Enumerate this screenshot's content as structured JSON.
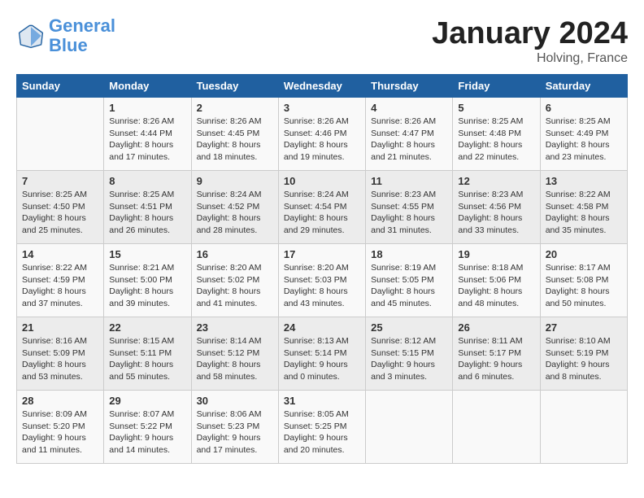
{
  "header": {
    "logo_line1": "General",
    "logo_line2": "Blue",
    "month": "January 2024",
    "location": "Holving, France"
  },
  "days_of_week": [
    "Sunday",
    "Monday",
    "Tuesday",
    "Wednesday",
    "Thursday",
    "Friday",
    "Saturday"
  ],
  "weeks": [
    [
      {
        "day": "",
        "content": ""
      },
      {
        "day": "1",
        "content": "Sunrise: 8:26 AM\nSunset: 4:44 PM\nDaylight: 8 hours\nand 17 minutes."
      },
      {
        "day": "2",
        "content": "Sunrise: 8:26 AM\nSunset: 4:45 PM\nDaylight: 8 hours\nand 18 minutes."
      },
      {
        "day": "3",
        "content": "Sunrise: 8:26 AM\nSunset: 4:46 PM\nDaylight: 8 hours\nand 19 minutes."
      },
      {
        "day": "4",
        "content": "Sunrise: 8:26 AM\nSunset: 4:47 PM\nDaylight: 8 hours\nand 21 minutes."
      },
      {
        "day": "5",
        "content": "Sunrise: 8:25 AM\nSunset: 4:48 PM\nDaylight: 8 hours\nand 22 minutes."
      },
      {
        "day": "6",
        "content": "Sunrise: 8:25 AM\nSunset: 4:49 PM\nDaylight: 8 hours\nand 23 minutes."
      }
    ],
    [
      {
        "day": "7",
        "content": "Sunrise: 8:25 AM\nSunset: 4:50 PM\nDaylight: 8 hours\nand 25 minutes."
      },
      {
        "day": "8",
        "content": "Sunrise: 8:25 AM\nSunset: 4:51 PM\nDaylight: 8 hours\nand 26 minutes."
      },
      {
        "day": "9",
        "content": "Sunrise: 8:24 AM\nSunset: 4:52 PM\nDaylight: 8 hours\nand 28 minutes."
      },
      {
        "day": "10",
        "content": "Sunrise: 8:24 AM\nSunset: 4:54 PM\nDaylight: 8 hours\nand 29 minutes."
      },
      {
        "day": "11",
        "content": "Sunrise: 8:23 AM\nSunset: 4:55 PM\nDaylight: 8 hours\nand 31 minutes."
      },
      {
        "day": "12",
        "content": "Sunrise: 8:23 AM\nSunset: 4:56 PM\nDaylight: 8 hours\nand 33 minutes."
      },
      {
        "day": "13",
        "content": "Sunrise: 8:22 AM\nSunset: 4:58 PM\nDaylight: 8 hours\nand 35 minutes."
      }
    ],
    [
      {
        "day": "14",
        "content": "Sunrise: 8:22 AM\nSunset: 4:59 PM\nDaylight: 8 hours\nand 37 minutes."
      },
      {
        "day": "15",
        "content": "Sunrise: 8:21 AM\nSunset: 5:00 PM\nDaylight: 8 hours\nand 39 minutes."
      },
      {
        "day": "16",
        "content": "Sunrise: 8:20 AM\nSunset: 5:02 PM\nDaylight: 8 hours\nand 41 minutes."
      },
      {
        "day": "17",
        "content": "Sunrise: 8:20 AM\nSunset: 5:03 PM\nDaylight: 8 hours\nand 43 minutes."
      },
      {
        "day": "18",
        "content": "Sunrise: 8:19 AM\nSunset: 5:05 PM\nDaylight: 8 hours\nand 45 minutes."
      },
      {
        "day": "19",
        "content": "Sunrise: 8:18 AM\nSunset: 5:06 PM\nDaylight: 8 hours\nand 48 minutes."
      },
      {
        "day": "20",
        "content": "Sunrise: 8:17 AM\nSunset: 5:08 PM\nDaylight: 8 hours\nand 50 minutes."
      }
    ],
    [
      {
        "day": "21",
        "content": "Sunrise: 8:16 AM\nSunset: 5:09 PM\nDaylight: 8 hours\nand 53 minutes."
      },
      {
        "day": "22",
        "content": "Sunrise: 8:15 AM\nSunset: 5:11 PM\nDaylight: 8 hours\nand 55 minutes."
      },
      {
        "day": "23",
        "content": "Sunrise: 8:14 AM\nSunset: 5:12 PM\nDaylight: 8 hours\nand 58 minutes."
      },
      {
        "day": "24",
        "content": "Sunrise: 8:13 AM\nSunset: 5:14 PM\nDaylight: 9 hours\nand 0 minutes."
      },
      {
        "day": "25",
        "content": "Sunrise: 8:12 AM\nSunset: 5:15 PM\nDaylight: 9 hours\nand 3 minutes."
      },
      {
        "day": "26",
        "content": "Sunrise: 8:11 AM\nSunset: 5:17 PM\nDaylight: 9 hours\nand 6 minutes."
      },
      {
        "day": "27",
        "content": "Sunrise: 8:10 AM\nSunset: 5:19 PM\nDaylight: 9 hours\nand 8 minutes."
      }
    ],
    [
      {
        "day": "28",
        "content": "Sunrise: 8:09 AM\nSunset: 5:20 PM\nDaylight: 9 hours\nand 11 minutes."
      },
      {
        "day": "29",
        "content": "Sunrise: 8:07 AM\nSunset: 5:22 PM\nDaylight: 9 hours\nand 14 minutes."
      },
      {
        "day": "30",
        "content": "Sunrise: 8:06 AM\nSunset: 5:23 PM\nDaylight: 9 hours\nand 17 minutes."
      },
      {
        "day": "31",
        "content": "Sunrise: 8:05 AM\nSunset: 5:25 PM\nDaylight: 9 hours\nand 20 minutes."
      },
      {
        "day": "",
        "content": ""
      },
      {
        "day": "",
        "content": ""
      },
      {
        "day": "",
        "content": ""
      }
    ]
  ]
}
